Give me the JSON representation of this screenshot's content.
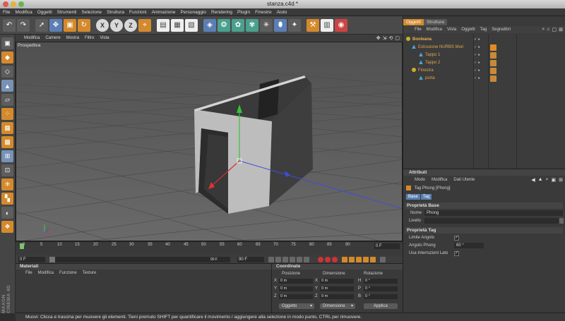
{
  "window": {
    "title": "stanza.c4d *"
  },
  "menu": [
    "File",
    "Modifica",
    "Oggetti",
    "Strumenti",
    "Selezione",
    "Struttura",
    "Funzioni",
    "Animazione",
    "Personaggio",
    "Rendering",
    "Plugin",
    "Finestre",
    "Aiuto"
  ],
  "viewport": {
    "menu": [
      "Modifica",
      "Camere",
      "Mostra",
      "Filtro",
      "Vista"
    ],
    "label": "Prospettiva"
  },
  "timeline": {
    "ticks": [
      "0",
      "5",
      "10",
      "15",
      "20",
      "25",
      "30",
      "35",
      "40",
      "45",
      "50",
      "55",
      "60",
      "65",
      "70",
      "75",
      "80",
      "85",
      "90"
    ],
    "frame": "0 F",
    "start": "0 F",
    "end": "90 F",
    "range_end": "90 F"
  },
  "materials": {
    "title": "Materiali",
    "menu": [
      "File",
      "Modifica",
      "Funzione",
      "Texture"
    ]
  },
  "coordinates": {
    "title": "Coordinate",
    "headers": [
      "Posizione",
      "Dimensione",
      "Rotazione"
    ],
    "rows": [
      {
        "axis": "X",
        "pos": "0 m",
        "dim_axis": "X",
        "dim": "0 m",
        "rot_axis": "H",
        "rot": "0 °"
      },
      {
        "axis": "Y",
        "pos": "0 m",
        "dim_axis": "Y",
        "dim": "0 m",
        "rot_axis": "P",
        "rot": "0 °"
      },
      {
        "axis": "Z",
        "pos": "0 m",
        "dim_axis": "Z",
        "dim": "0 m",
        "rot_axis": "B",
        "rot": "0 °"
      }
    ],
    "mode_select": "Oggetto",
    "size_select": "Dimensione",
    "apply": "Applica"
  },
  "status": "Muovi: Clicca e trascina per muovere gli elementi. Tieni premuto SHIFT per quantificare il movimento / aggiungere alla selezione in modo punto, CTRL per rimuovere.",
  "branding": "MAXON CINEMA 4D",
  "objects": {
    "tabs": [
      "Oggetti",
      "Struttura"
    ],
    "menu": [
      "File",
      "Modifica",
      "Vista",
      "Oggetti",
      "Tag",
      "Segnalibri"
    ],
    "items": [
      {
        "name": "Booleana",
        "indent": 0
      },
      {
        "name": "Estrusione NURBS Muri",
        "indent": 1
      },
      {
        "name": "Tappo 1",
        "indent": 2
      },
      {
        "name": "Tappo 2",
        "indent": 2
      },
      {
        "name": "Finestra",
        "indent": 1
      },
      {
        "name": "porta",
        "indent": 2
      }
    ]
  },
  "attributes": {
    "title": "Attributi",
    "menu": [
      "Modo",
      "Modifica",
      "Dati Utente"
    ],
    "tag_title": "Tag Phong [Phong]",
    "tabs": [
      "Base",
      "Tag"
    ],
    "section_base": "Proprietà Base",
    "name_label": "Nome",
    "name_value": "Phong",
    "level_label": "Livello",
    "section_tag": "Proprietà Tag",
    "limit_angle_label": "Limite Angolo",
    "phong_angle_label": "Angolo Phong",
    "phong_angle_value": "60 °",
    "use_edges_label": "Usa Interruzioni Lato"
  },
  "colors": {
    "accent": "#d48a2c",
    "select": "#7892b6"
  }
}
